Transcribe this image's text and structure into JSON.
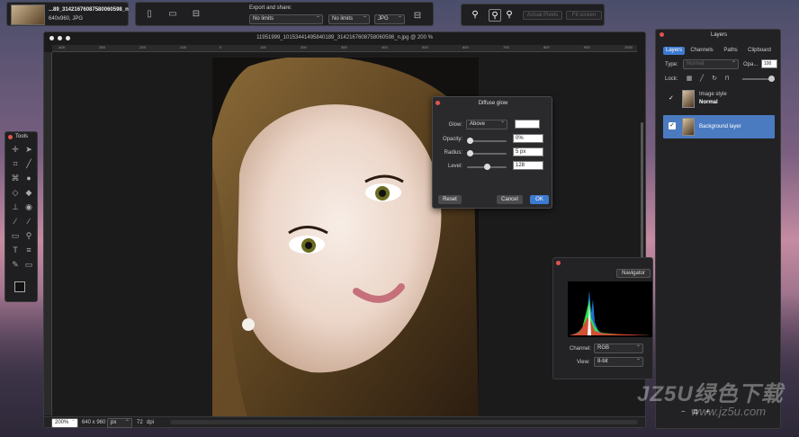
{
  "file": {
    "name": "...89_31421676087580060598_n",
    "info": "640x960, JPG"
  },
  "export": {
    "title": "Export and share:",
    "width": "No limits",
    "height": "No limits",
    "format": "JPG"
  },
  "view": {
    "actual_pixels": "Actual Pixels",
    "fit_screen": "Fit screen"
  },
  "document": {
    "title": "11951999_1015344149584018​9_3142167608758060598_n.jpg @ 200 %",
    "ruler_ticks": [
      "-400",
      "-300",
      "-200",
      "-100",
      "0",
      "100",
      "200",
      "300",
      "400",
      "500",
      "600",
      "700",
      "800",
      "900",
      "1000"
    ],
    "zoom": "200%",
    "size": "640 x 960",
    "unit": "px",
    "dpi_value": "72",
    "dpi_label": "dpi"
  },
  "tools": {
    "title": "Tools"
  },
  "dialog": {
    "title": "Diffuse glow",
    "glow_label": "Glow:",
    "glow_mode": "Above",
    "opacity_label": "Opacity:",
    "opacity_value": "0%",
    "opacity_fraction": 0.0,
    "radius_label": "Radius:",
    "radius_value": "5 px",
    "level_label": "Level:",
    "level_value": "128",
    "reset": "Reset",
    "cancel": "Cancel",
    "ok": "OK"
  },
  "navigator": {
    "title": "Navigator",
    "channel_label": "Channel:",
    "channel_value": "RGB",
    "view_label": "View:",
    "view_value": "8-bit"
  },
  "layers": {
    "title": "Layers",
    "tabs": [
      "Layers",
      "Channels",
      "Paths",
      "Clipboard"
    ],
    "type_label": "Type:",
    "type_value": "Normal",
    "opacity_label": "Opa...",
    "opacity_value": "100",
    "lock_label": "Lock:",
    "items": [
      {
        "name": "Image style",
        "mode": "Normal"
      },
      {
        "name": "Background layer"
      }
    ]
  },
  "watermark": {
    "main": "JZ5U绿色下载",
    "url": "www.jz5u.com"
  },
  "colors": {
    "accent": "#3d7bd1",
    "close": "#e0554f",
    "selected_row": "#4a7ac0"
  }
}
